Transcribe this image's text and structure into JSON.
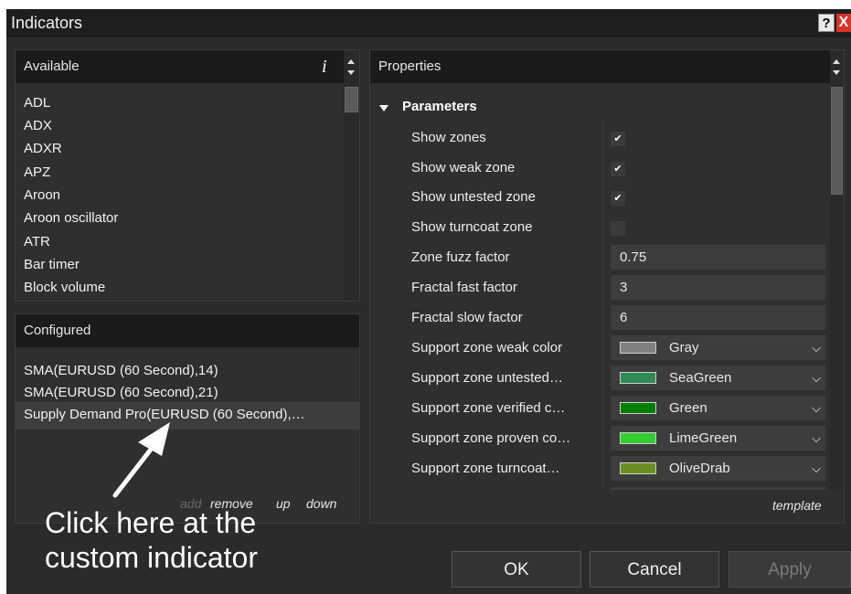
{
  "window": {
    "title": "Indicators",
    "help_label": "?",
    "close_label": "X"
  },
  "available": {
    "header": "Available",
    "info_icon_label": "i",
    "items": [
      "ADL",
      "ADX",
      "ADXR",
      "APZ",
      "Aroon",
      "Aroon oscillator",
      "ATR",
      "Bar timer",
      "Block volume"
    ]
  },
  "configured": {
    "header": "Configured",
    "items": [
      "SMA(EURUSD (60 Second),14)",
      "SMA(EURUSD (60 Second),21)",
      "Supply Demand Pro(EURUSD (60 Second),…"
    ],
    "actions": {
      "add": "add",
      "remove": "remove",
      "up": "up",
      "down": "down"
    }
  },
  "properties": {
    "header": "Properties",
    "section": "Parameters",
    "checks": [
      {
        "label": "Show zones",
        "checked": true
      },
      {
        "label": "Show weak zone",
        "checked": true
      },
      {
        "label": "Show untested zone",
        "checked": true
      },
      {
        "label": "Show turncoat zone",
        "checked": false
      }
    ],
    "values": [
      {
        "label": "Zone fuzz factor",
        "value": "0.75"
      },
      {
        "label": "Fractal fast factor",
        "value": "3"
      },
      {
        "label": "Fractal slow factor",
        "value": "6"
      }
    ],
    "colors": [
      {
        "label": "Support zone weak color",
        "name": "Gray",
        "hex": "#808080"
      },
      {
        "label": "Support zone untested…",
        "name": "SeaGreen",
        "hex": "#2e8b57"
      },
      {
        "label": "Support zone verified c…",
        "name": "Green",
        "hex": "#008000"
      },
      {
        "label": "Support zone proven co…",
        "name": "LimeGreen",
        "hex": "#32cd32"
      },
      {
        "label": "Support zone turncoat…",
        "name": "OliveDrab",
        "hex": "#6b8e23"
      }
    ],
    "template_label": "template"
  },
  "buttons": {
    "ok": "OK",
    "cancel": "Cancel",
    "apply": "Apply"
  },
  "annotation": {
    "line1": "Click here at the",
    "line2": "custom indicator"
  },
  "icons": {
    "check": "✔",
    "chevron": "❯"
  }
}
